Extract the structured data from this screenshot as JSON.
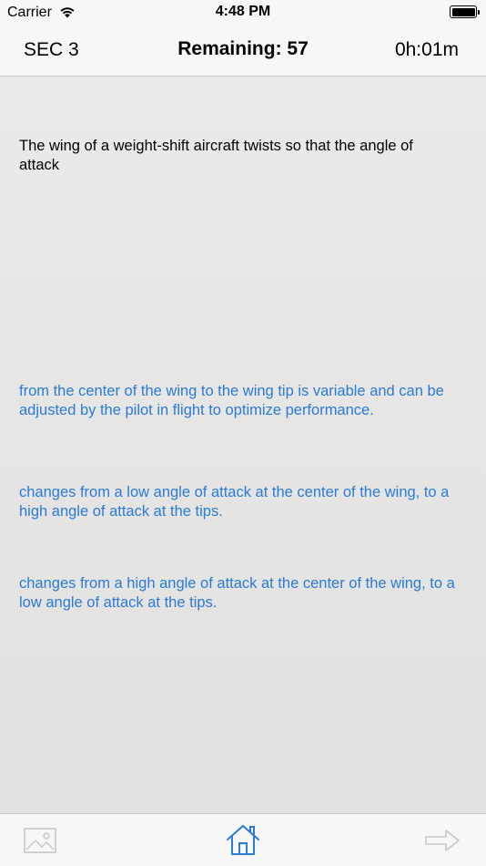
{
  "status_bar": {
    "carrier": "Carrier",
    "time": "4:48 PM"
  },
  "nav": {
    "section": "SEC 3",
    "remaining": "Remaining: 57",
    "timer": "0h:01m"
  },
  "question": {
    "text": "The wing of a weight-shift aircraft twists so that the angle of attack"
  },
  "answers": [
    "from the center of the wing to the wing tip is variable and can be adjusted by the pilot in flight to optimize performance.",
    "changes from a low angle of attack at the center of the wing, to a high angle of attack at the tips.",
    "changes from a high angle of attack at the center of the wing, to a low angle of attack at the tips."
  ],
  "tab_bar": {
    "icons": [
      "image-icon",
      "home-icon",
      "arrow-right-icon"
    ],
    "active_color": "#2a7bd8",
    "inactive_color": "#c7c7cc"
  },
  "colors": {
    "answer_link": "#2a7bd8",
    "background": "#e8e7e5"
  }
}
